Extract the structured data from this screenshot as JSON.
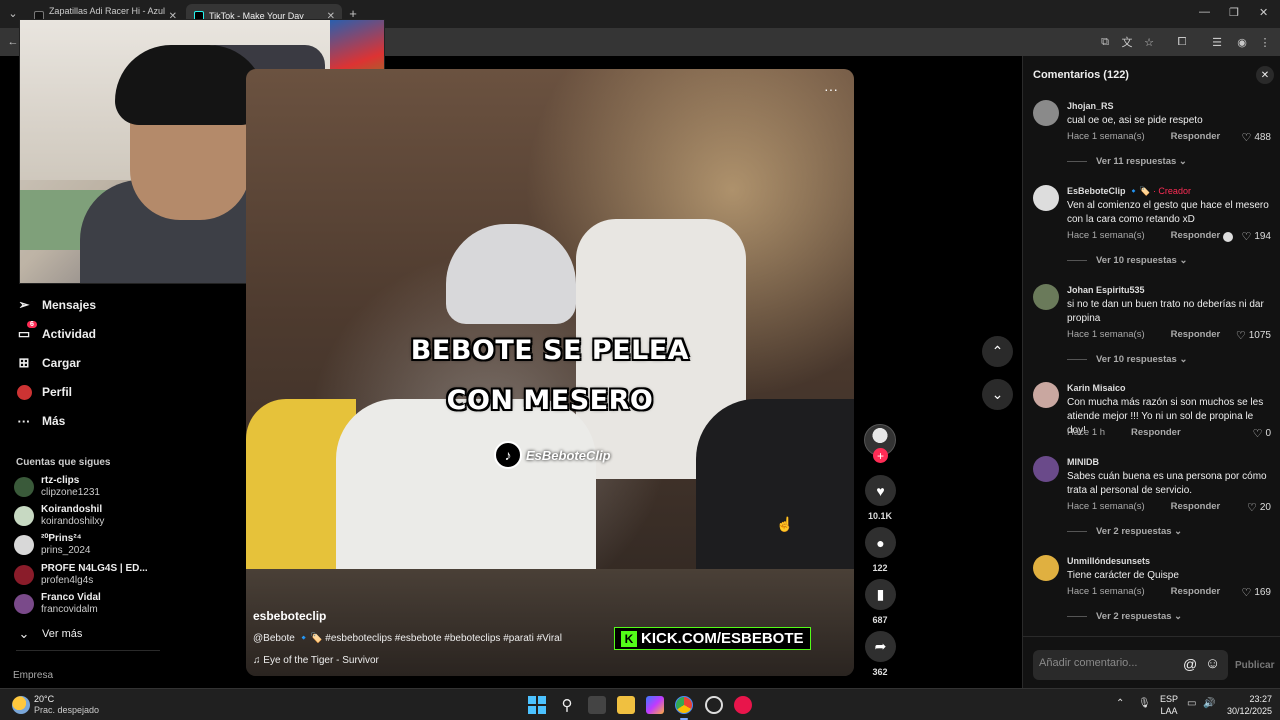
{
  "browser": {
    "tabs": [
      {
        "title": "Zapatillas Adi Racer Hi - Azul ac",
        "active": false
      },
      {
        "title": "TikTok - Make Your Day",
        "active": true
      }
    ],
    "new_tab_label": "+"
  },
  "sidebar": {
    "nav": [
      {
        "label": "Mensajes",
        "icon": "send-icon"
      },
      {
        "label": "Actividad",
        "icon": "inbox-icon",
        "badge": "6"
      },
      {
        "label": "Cargar",
        "icon": "upload-icon"
      },
      {
        "label": "Perfil",
        "icon": "profile-avatar"
      },
      {
        "label": "Más",
        "icon": "more-icon"
      }
    ],
    "following_title": "Cuentas que sigues",
    "following": [
      {
        "name": "rtz-clips",
        "handle": "clipzone1231",
        "color": "#3a5a3a"
      },
      {
        "name": "Koirandoshil",
        "handle": "koirandoshilxy",
        "color": "#c7d9c2"
      },
      {
        "name": "²⁰Prins²⁴",
        "handle": "prins_2024",
        "color": "#d8d8d8"
      },
      {
        "name": "PROFE N4LG4S | ED...",
        "handle": "profen4lg4s",
        "color": "#8a1c2a"
      },
      {
        "name": "Franco Vidal",
        "handle": "francovidalm",
        "color": "#7a4a8a"
      }
    ],
    "see_more": "Ver más",
    "footer": "Empresa"
  },
  "video": {
    "overlay_line1": "BEBOTE SE PELEA",
    "overlay_line2": "CON MESERO",
    "watermark": "EsBeboteClip",
    "kick_text": "KICK.COM/ESBEBOTE",
    "author": "esbeboteclip",
    "description": "@Bebote 🔹🏷️ #esbeboteclips #esbebote #beboteclips #parati #Viral",
    "music": "Eye of the Tiger - Survivor",
    "likes": "10.1K",
    "comments": "122",
    "saves": "687",
    "shares": "362"
  },
  "comments": {
    "title": "Comentarios (122)",
    "input_placeholder": "Añadir comentario...",
    "post_label": "Publicar",
    "items": [
      {
        "user": "Jhojan_RS",
        "text": "cual oe oe, asi se pide respeto",
        "time": "Hace 1 semana(s)",
        "reply": "Responder",
        "likes": "488",
        "replies": "Ver 11 respuestas",
        "color": "#8a8a8a"
      },
      {
        "user": "EsBeboteClip 🔹🏷️",
        "creator": "· Creador",
        "text": "Ven al comienzo el gesto que hace el mesero con la cara como retando xD",
        "time": "Hace 1 semana(s)",
        "reply": "Responder",
        "likes": "194",
        "replies": "Ver 10 respuestas",
        "color": "#dddddd"
      },
      {
        "user": "Johan Espiritu535",
        "text": "si no te dan un buen trato no deberías ni dar propina",
        "time": "Hace 1 semana(s)",
        "reply": "Responder",
        "likes": "1075",
        "replies": "Ver 10 respuestas",
        "color": "#6a7a5a"
      },
      {
        "user": "Karin Misaico",
        "text": "Con mucha más razón si son muchos se les atiende mejor !!! Yo ni un sol de propina le doy!",
        "time": "Hace 1 h",
        "reply": "Responder",
        "likes": "0",
        "replies": "",
        "color": "#c9a7a0"
      },
      {
        "user": "MINIDB",
        "text": "Sabes cuán buena es una persona por cómo trata al personal de servicio.",
        "time": "Hace 1 semana(s)",
        "reply": "Responder",
        "likes": "20",
        "replies": "Ver 2 respuestas",
        "color": "#6a4a8a"
      },
      {
        "user": "Unmillóndesunsets",
        "text": "Tiene carácter de Quispe",
        "time": "Hace 1 semana(s)",
        "reply": "Responder",
        "likes": "169",
        "replies": "Ver 2 respuestas",
        "color": "#e0b040"
      }
    ]
  },
  "taskbar": {
    "temp": "20°C",
    "weather": "Prac. despejado",
    "lang1": "ESP",
    "lang2": "LAA",
    "time": "23:27",
    "date": "30/12/2025"
  }
}
